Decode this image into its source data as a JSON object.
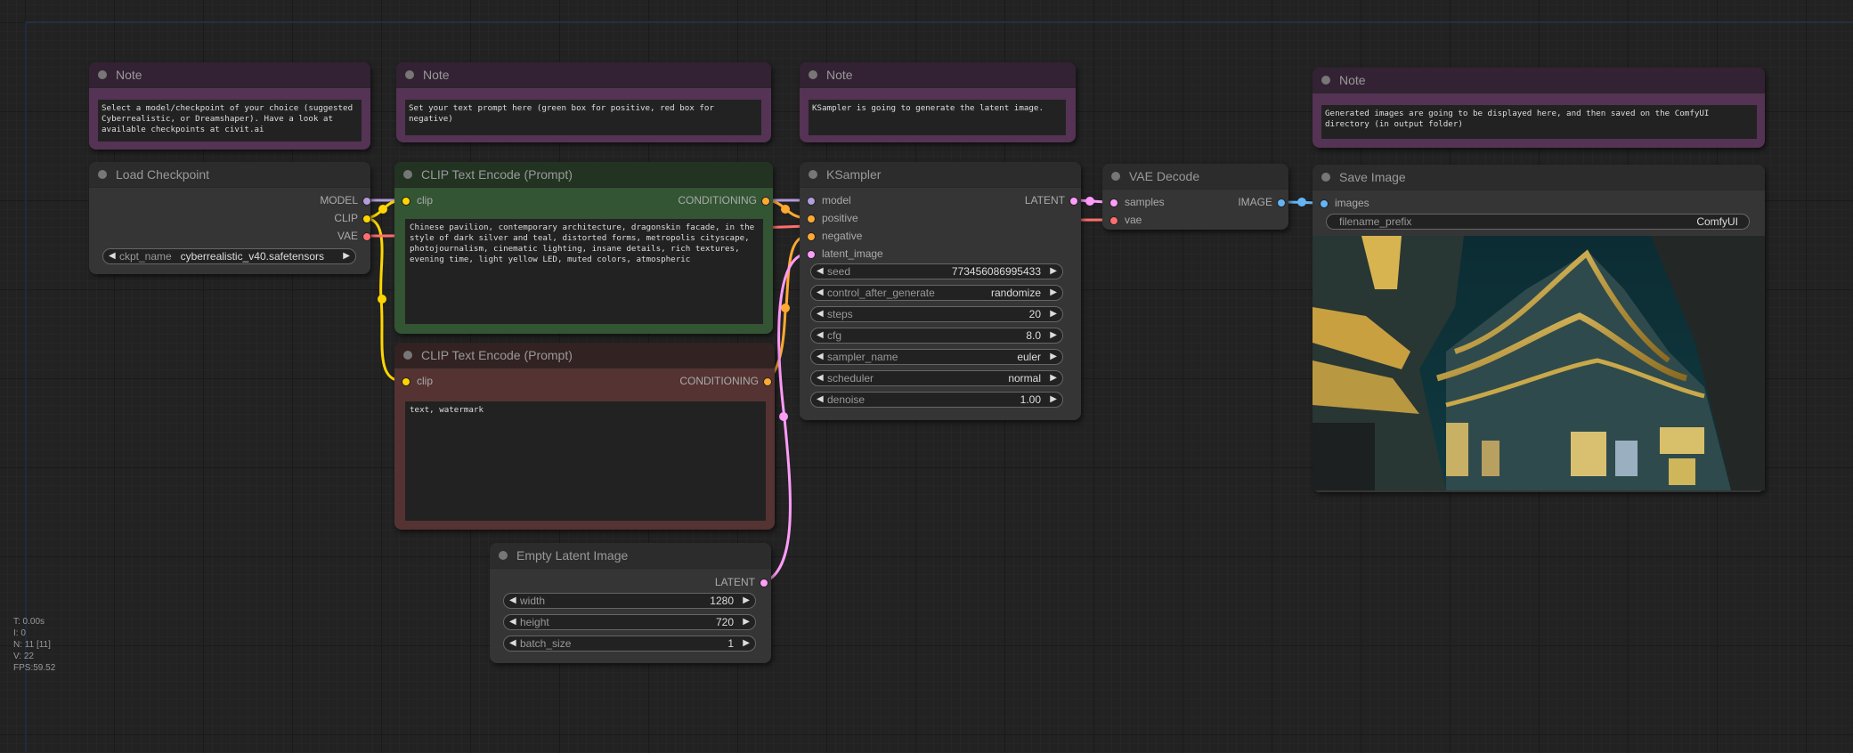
{
  "notes": [
    {
      "title": "Note",
      "text": "Select a model/checkpoint of your choice (suggested Cyberrealistic, or Dreamshaper). Have a look at available checkpoints at civit.ai"
    },
    {
      "title": "Note",
      "text": "Set your text prompt here (green box for positive, red box for negative)"
    },
    {
      "title": "Note",
      "text": "KSampler is going to generate the latent image."
    },
    {
      "title": "Note",
      "text": "Generated images are going to be displayed here, and then saved on the ComfyUI directory (in output folder)"
    }
  ],
  "load_checkpoint": {
    "title": "Load Checkpoint",
    "outputs": [
      "MODEL",
      "CLIP",
      "VAE"
    ],
    "ckpt_label": "ckpt_name",
    "ckpt_value": "cyberrealistic_v40.safetensors"
  },
  "clip_positive": {
    "title": "CLIP Text Encode (Prompt)",
    "input": "clip",
    "output": "CONDITIONING",
    "text": "Chinese pavilion, contemporary architecture, dragonskin facade, in the style of dark silver and teal, distorted forms, metropolis cityscape, photojournalism, cinematic lighting, insane details, rich textures, evening time, light yellow LED, muted colors, atmospheric"
  },
  "clip_negative": {
    "title": "CLIP Text Encode (Prompt)",
    "input": "clip",
    "output": "CONDITIONING",
    "text": "text, watermark"
  },
  "ksampler": {
    "title": "KSampler",
    "inputs": [
      "model",
      "positive",
      "negative",
      "latent_image"
    ],
    "output": "LATENT",
    "widgets": [
      {
        "label": "seed",
        "value": "773456086995433"
      },
      {
        "label": "control_after_generate",
        "value": "randomize"
      },
      {
        "label": "steps",
        "value": "20"
      },
      {
        "label": "cfg",
        "value": "8.0"
      },
      {
        "label": "sampler_name",
        "value": "euler"
      },
      {
        "label": "scheduler",
        "value": "normal"
      },
      {
        "label": "denoise",
        "value": "1.00"
      }
    ]
  },
  "vae_decode": {
    "title": "VAE Decode",
    "inputs": [
      "samples",
      "vae"
    ],
    "output": "IMAGE"
  },
  "save_image": {
    "title": "Save Image",
    "input": "images",
    "prefix_label": "filename_prefix",
    "prefix_value": "ComfyUI"
  },
  "empty_latent": {
    "title": "Empty Latent Image",
    "output": "LATENT",
    "widgets": [
      {
        "label": "width",
        "value": "1280"
      },
      {
        "label": "height",
        "value": "720"
      },
      {
        "label": "batch_size",
        "value": "1"
      }
    ]
  },
  "stats": {
    "t": "T: 0.00s",
    "i": "I: 0",
    "n": "N: 11 [11]",
    "v": "V: 22",
    "fps": "FPS:59.52"
  },
  "colors": {
    "model": "#b39ddb",
    "clip": "#ffd500",
    "vae": "#ff6e6e",
    "conditioning": "#ffa931",
    "latent": "#ff9cf9",
    "image": "#64b5f6"
  },
  "icons": {
    "arrow_left": "◀",
    "arrow_right": "▶"
  }
}
